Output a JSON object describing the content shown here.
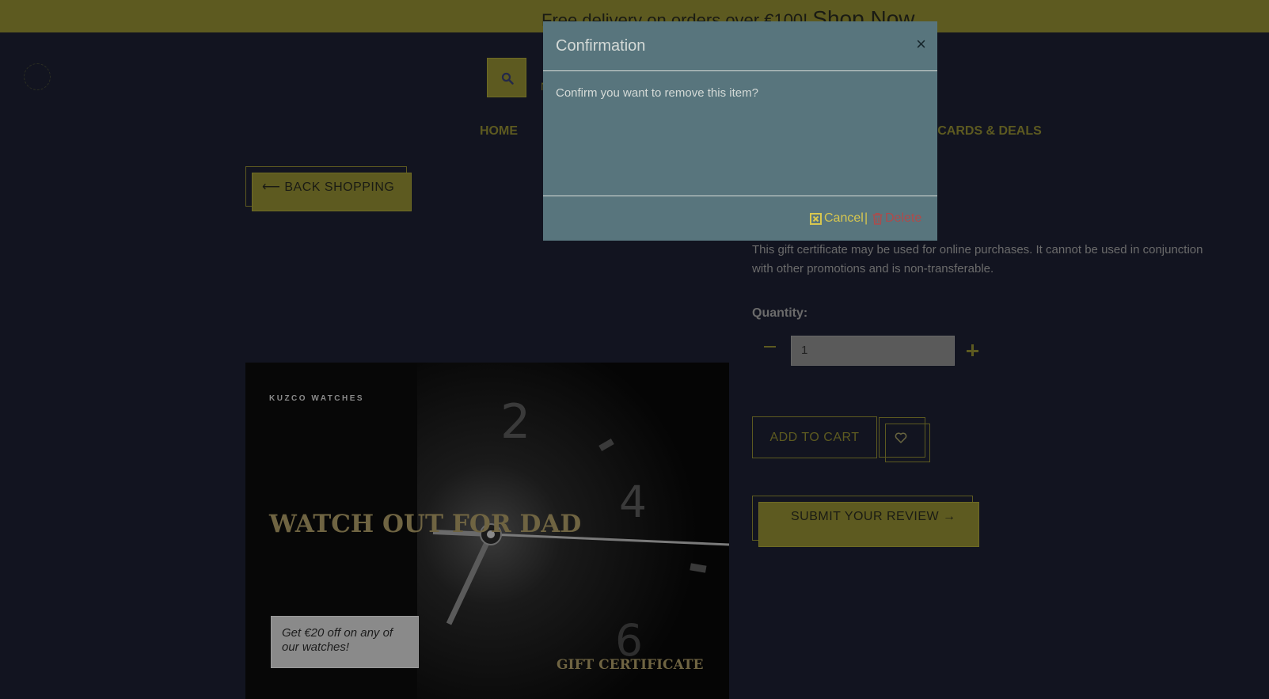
{
  "promo": {
    "text": "Free delivery on orders over €100!",
    "link": "Shop Now"
  },
  "header": {
    "search_hint": "N"
  },
  "nav": {
    "home": "HOME",
    "deals": "T CARDS & DEALS"
  },
  "back_button": "⟵ BACK SHOPPING",
  "product_image": {
    "brand": "KUZCO WATCHES",
    "headline": "WATCH OUT FOR DAD",
    "offer": "Get €20 off on any of our watches!",
    "label": "GIFT CERTIFICATE"
  },
  "product": {
    "description": "This gift certificate may be used for online purchases. It cannot be used in conjunction with other promotions and is non-transferable.",
    "quantity_label": "Quantity:",
    "quantity_value": "1",
    "add_to_cart": "ADD TO CART",
    "submit_review": "SUBMIT YOUR REVIEW →"
  },
  "modal": {
    "title": "Confirmation",
    "close": "×",
    "body": "Confirm you want to remove this item?",
    "cancel": "Cancel",
    "separator": "|",
    "delete": "Delete"
  },
  "icons": {
    "search": "search-icon",
    "heart": "heart-icon",
    "close": "close-icon",
    "cancel": "x-square-icon",
    "delete": "trash-icon"
  },
  "colors": {
    "accent_dimmed": "#5d5a20",
    "modal_bg": "#58757d",
    "cancel": "#d8c74f",
    "delete": "#b04a4a"
  }
}
